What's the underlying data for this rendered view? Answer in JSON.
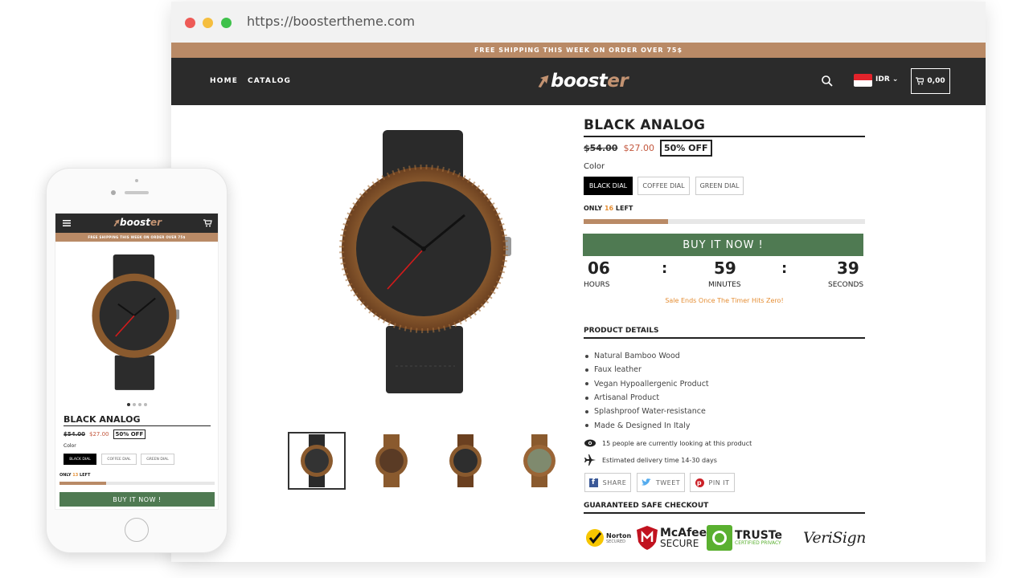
{
  "browser": {
    "url": "https://boostertheme.com"
  },
  "store": {
    "promo": "FREE SHIPPING THIS WEEK ON ORDER OVER 75$",
    "nav": [
      "HOME",
      "CATALOG"
    ],
    "logo": {
      "b": "boost",
      "er": "er"
    },
    "currency": "IDR",
    "cart_total": "0,00"
  },
  "product": {
    "title": "BLACK ANALOG",
    "old_price": "$54.00",
    "new_price": "$27.00",
    "discount": "50% OFF",
    "color_label": "Color",
    "colors": [
      "BLACK DIAL",
      "COFFEE DIAL",
      "GREEN DIAL"
    ],
    "stock_prefix": "ONLY",
    "stock_num": "16",
    "stock_suffix": "LEFT",
    "stock_fraction": 0.3,
    "buy_label": "BUY IT NOW !",
    "timer": {
      "hours": "06",
      "minutes": "59",
      "seconds": "39",
      "hours_label": "HOURS",
      "minutes_label": "MINUTES",
      "seconds_label": "SECONDS",
      "note": "Sale Ends Once The Timer Hits Zero!"
    },
    "details_title": "PRODUCT DETAILS",
    "details": [
      "Natural Bamboo Wood",
      "Faux leather",
      "Vegan Hypoallergenic Product",
      "Artisanal Product",
      "Splashproof Water-resistance",
      "Made & Designed In Italy"
    ],
    "viewers": "15 people are currently looking at this product",
    "delivery": "Estimated delivery time 14-30 days",
    "share": [
      "SHARE",
      "TWEET",
      "PIN IT"
    ],
    "checkout_title": "GUARANTEED SAFE CHECKOUT",
    "badges": {
      "norton": "Norton",
      "norton_sub": "SECURED",
      "mcafee": "McAfee",
      "mcafee_sub": "SECURE",
      "truste": "TRUSTe",
      "truste_sub": "CERTIFIED PRIVACY",
      "verisign": "VeriSign"
    }
  },
  "mobile": {
    "stock_num": "13"
  },
  "colors": {
    "accent": "#b98a66",
    "buy": "#4f7a52",
    "navbar": "#2b2b2b",
    "sale": "#c3573d",
    "timer_note": "#e58e34"
  }
}
